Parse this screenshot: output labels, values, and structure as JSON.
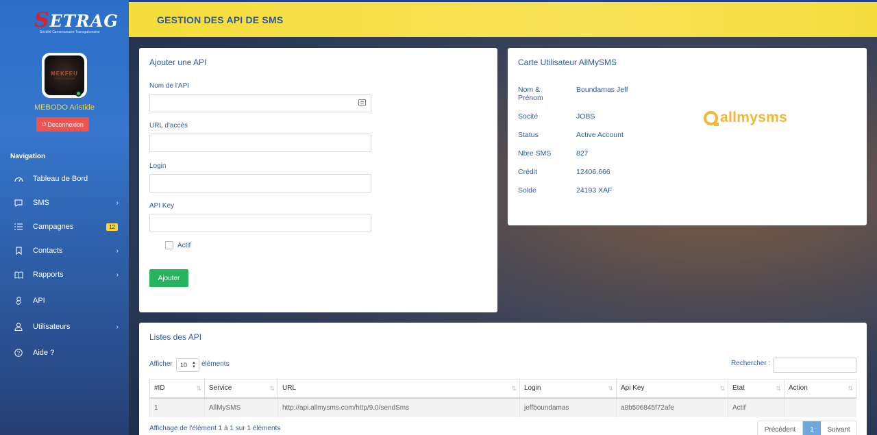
{
  "brand": {
    "name": "ETRAG",
    "initial": "S",
    "tagline": "Société Camerounaise Transgabonaise"
  },
  "user": {
    "name": "MEBODO Aristide",
    "logout_label": "Deconnexion",
    "avatar_text": "MEKFEU",
    "avatar_sub": "STREET ALBUM"
  },
  "nav": {
    "title": "Navigation",
    "items": [
      {
        "label": "Tableau de Bord",
        "icon": "dashboard-icon"
      },
      {
        "label": "SMS",
        "icon": "chat-icon",
        "chevron": "›"
      },
      {
        "label": "Campagnes",
        "icon": "list-icon",
        "badge": "12"
      },
      {
        "label": "Contacts",
        "icon": "bookmark-icon",
        "chevron": "›"
      },
      {
        "label": "Rapports",
        "icon": "book-icon",
        "chevron": "›"
      },
      {
        "label": "API",
        "icon": "link-icon"
      },
      {
        "label": "Utilisateurs",
        "icon": "user-icon",
        "chevron": "›"
      },
      {
        "label": "Aide ?",
        "icon": "help-icon"
      }
    ]
  },
  "header": {
    "title": "GESTION DES API DE SMS"
  },
  "add_form": {
    "title": "Ajouter une API",
    "fields": [
      {
        "label": "Nom de l'API",
        "value": ""
      },
      {
        "label": "URL d'accès",
        "value": ""
      },
      {
        "label": "Login",
        "value": ""
      },
      {
        "label": "API Key",
        "value": ""
      }
    ],
    "checkbox_label": "Actif",
    "submit_label": "Ajouter"
  },
  "user_card": {
    "title": "Carte Utilisateur AllMySMS",
    "rows": [
      {
        "key": "Nom & Prénom",
        "value": "Boundamas Jeff"
      },
      {
        "key": "Socité",
        "value": "JOBS"
      },
      {
        "key": "Status",
        "value": "Active Account"
      },
      {
        "key": "Nbre SMS",
        "value": "827"
      },
      {
        "key": "Crédit",
        "value": "12406.666"
      },
      {
        "key": "Solde",
        "value": "24193 XAF"
      }
    ],
    "logo_text": "allmysms"
  },
  "api_list": {
    "title": "Listes des API",
    "show_prefix": "Afficher",
    "page_size": "10",
    "show_suffix": "éléments",
    "search_label": "Rechercher :",
    "columns": [
      "#ID",
      "Service",
      "URL",
      "Login",
      "Api Key",
      "Etat",
      "Action"
    ],
    "rows": [
      [
        "1",
        "AllMySMS",
        "http://api.allmysms.com/http/9.0/sendSms",
        "jeffboundamas",
        "a8b506845f72afe",
        "Actif",
        ""
      ]
    ],
    "info": "Affichage de l'élément 1 à 1 sur 1 éléments",
    "pager": {
      "prev": "Précédent",
      "current": "1",
      "next": "Suivant"
    }
  }
}
